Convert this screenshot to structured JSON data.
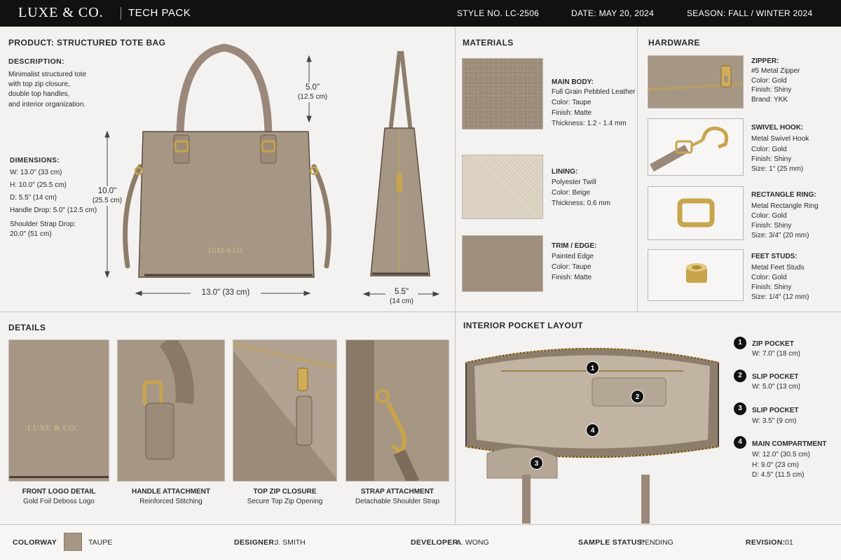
{
  "header": {
    "brand": "LUXE & CO.",
    "doc_type": "TECH PACK",
    "style_no": "STYLE NO.  LC-2506",
    "date": "DATE: MAY 20, 2024",
    "season": "SEASON: FALL / WINTER 2024"
  },
  "product": {
    "title": "PRODUCT: STRUCTURED TOTE BAG",
    "description_heading": "DESCRIPTION:",
    "description_lines": [
      "Minimalist structured tote",
      "with top zip closure,",
      "double top handles,",
      "and interior organization."
    ],
    "dimensions_heading": "DIMENSIONS:",
    "dimension_lines": [
      "W: 13.0\" (33 cm)",
      "H: 10.0\" (25.5 cm)",
      "D: 5.5\" (14 cm)",
      "Handle Drop: 5.0\" (12.5 cm)",
      "Shoulder Strap Drop:",
      "20.0\" (51 cm)"
    ],
    "labels": {
      "height_in": "10.0\"",
      "height_cm": "(25.5 cm)",
      "width": "13.0\" (33 cm)",
      "handle_in": "5.0\"",
      "handle_cm": "(12.5 cm)",
      "depth_in": "5.5\"",
      "depth_cm": "(14 cm)"
    },
    "bag_logo": "LUXE & CO."
  },
  "materials": {
    "title": "MATERIALS",
    "items": [
      {
        "name": "MAIN BODY:",
        "lines": [
          "Full Grain Pebbled Leather",
          "Color: Taupe",
          "Finish: Matte",
          "Thickness: 1.2 - 1.4 mm"
        ]
      },
      {
        "name": "LINING:",
        "lines": [
          "Polyester Twill",
          "Color: Beige",
          "Thickness: 0.6 mm"
        ]
      },
      {
        "name": "TRIM / EDGE:",
        "lines": [
          "Painted Edge",
          "Color: Taupe",
          "Finish: Matte"
        ]
      }
    ]
  },
  "hardware": {
    "title": "HARDWARE",
    "items": [
      {
        "name": "ZIPPER:",
        "lines": [
          "#5 Metal Zipper",
          "Color: Gold",
          "Finish: Shiny",
          "Brand: YKK"
        ]
      },
      {
        "name": "SWIVEL HOOK:",
        "lines": [
          "Metal Swivel Hook",
          "Color: Gold",
          "Finish: Shiny",
          "Size: 1\" (25 mm)"
        ]
      },
      {
        "name": "RECTANGLE RING:",
        "lines": [
          "Metal Rectangle Ring",
          "Color: Gold",
          "Finish: Shiny",
          "Size: 3/4\" (20 mm)"
        ]
      },
      {
        "name": "FEET STUDS:",
        "lines": [
          "Metal Feet Studs",
          "Color: Gold",
          "Finish: Shiny",
          "Size: 1/4\" (12 mm)"
        ]
      }
    ]
  },
  "details": {
    "title": "DETAILS",
    "items": [
      {
        "title": "FRONT LOGO DETAIL",
        "subtitle": "Gold Foil Deboss Logo"
      },
      {
        "title": "HANDLE ATTACHMENT",
        "subtitle": "Reinforced Stitching"
      },
      {
        "title": "TOP ZIP CLOSURE",
        "subtitle": "Secure Top Zip Opening"
      },
      {
        "title": "STRAP ATTACHMENT",
        "subtitle": "Detachable Shoulder Strap"
      }
    ],
    "logo_text": "LUXE & CO."
  },
  "interior": {
    "title": "INTERIOR POCKET LAYOUT",
    "pockets": [
      {
        "num": "1",
        "name": "ZIP POCKET",
        "lines": [
          "W: 7.0\" (18 cm)"
        ]
      },
      {
        "num": "2",
        "name": "SLIP POCKET",
        "lines": [
          "W: 5.0\" (13 cm)"
        ]
      },
      {
        "num": "3",
        "name": "SLIP POCKET",
        "lines": [
          "W: 3.5\" (9 cm)"
        ]
      },
      {
        "num": "4",
        "name": "MAIN COMPARTMENT",
        "lines": [
          "W: 12.0\" (30.5 cm)",
          "H: 9.0\" (23 cm)",
          "D: 4.5\" (11.5 cm)"
        ]
      }
    ]
  },
  "footer": {
    "colorway_label": "COLORWAY",
    "colorway_value": "TAUPE",
    "colorway_color": "#a69684",
    "designer_label": "DESIGNER:",
    "designer_value": "J. SMITH",
    "developer_label": "DEVELOPER:",
    "developer_value": "A. WONG",
    "status_label": "SAMPLE STATUS:",
    "status_value": "PENDING",
    "revision_label": "REVISION:",
    "revision_value": "01"
  }
}
